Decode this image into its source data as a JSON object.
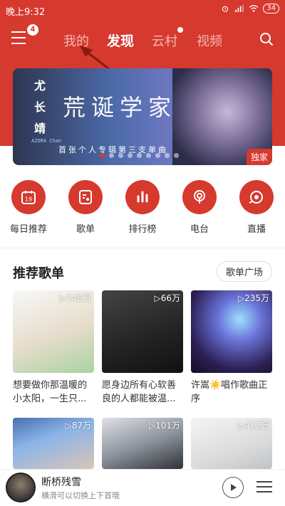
{
  "status": {
    "time": "晚上9:32",
    "battery": "34"
  },
  "header": {
    "badge": "4",
    "tabs": [
      {
        "label": "我的"
      },
      {
        "label": "发现"
      },
      {
        "label": "云村"
      },
      {
        "label": "视频"
      }
    ]
  },
  "banner": {
    "artist": "尤长靖",
    "subtitle": "首张个人专辑第三支单曲",
    "azora": "AZORA Chan",
    "title_art": "荒诞学家",
    "tag": "独家"
  },
  "shortcuts": [
    {
      "label": "每日推荐",
      "icon": "calendar-icon",
      "day": "19"
    },
    {
      "label": "歌单",
      "icon": "playlist-icon"
    },
    {
      "label": "排行榜",
      "icon": "chart-icon"
    },
    {
      "label": "电台",
      "icon": "radio-icon"
    },
    {
      "label": "直播",
      "icon": "live-icon"
    }
  ],
  "section": {
    "title": "推荐歌单",
    "more": "歌单广场"
  },
  "playlists": [
    {
      "count": "▷145万",
      "name": "想要做你那温暖的小太阳，一生只..."
    },
    {
      "count": "▷66万",
      "name": "愿身边所有心软善良的人都能被温..."
    },
    {
      "count": "▷235万",
      "name": "许嵩☀️唱作歌曲正序"
    },
    {
      "count": "▷87万",
      "name": ""
    },
    {
      "count": "▷101万",
      "name": ""
    },
    {
      "count": "▷412万",
      "name": ""
    }
  ],
  "player": {
    "title": "断桥残雪",
    "subtitle": "横滑可以切换上下首哦"
  }
}
